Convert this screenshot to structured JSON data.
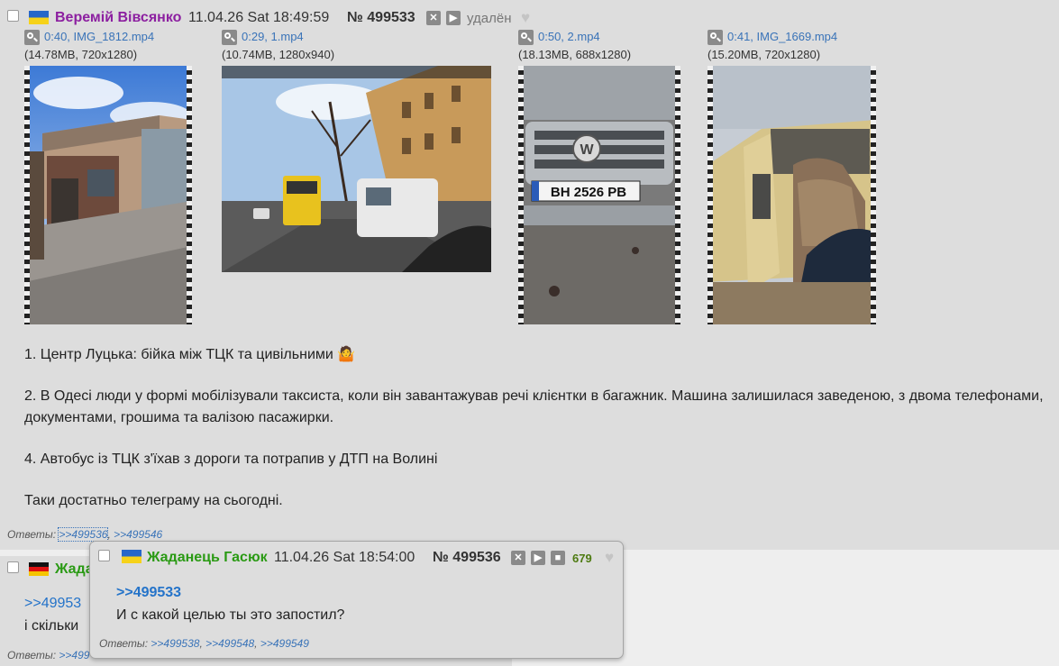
{
  "post1": {
    "name": "Веремій Вівсянко",
    "datetime": "11.04.26 Sat 18:49:59",
    "number": "№ 499533",
    "status": "удалён",
    "files": [
      {
        "label": "0:40, IMG_1812.mp4",
        "info": "(14.78MB, 720x1280)"
      },
      {
        "label": "0:29, 1.mp4",
        "info": "(10.74MB, 1280x940)"
      },
      {
        "label": "0:50, 2.mp4",
        "info": "(18.13MB, 688x1280)"
      },
      {
        "label": "0:41, IMG_1669.mp4",
        "info": "(15.20MB, 720x1280)"
      }
    ],
    "plate_text": "BH 2526 PB",
    "body": [
      "1. Центр Луцька: бійка між ТЦК та цивільними 🤷",
      "2. В Одесі люди у формі мобілізували таксиста, коли він завантажував речі клієнтки в багажник. Машина залишилася заведеною, з двома телефонами, документами, грошима та валізою пасажирки.",
      "4. Автобус із ТЦК з'їхав з дороги та потрапив у ДТП на Волині",
      "Таки достатньо телеграму на сьогодні."
    ],
    "replies_label": "Ответы:",
    "replies": [
      ">>499536",
      ">>499546"
    ]
  },
  "post2": {
    "name_partial": "Жада",
    "quote_partial": ">>49953",
    "text_partial": "і скільки",
    "replies_label": "Ответы:",
    "reply_partial": ">>499"
  },
  "popup": {
    "name": "Жаданець Гасюк",
    "datetime": "11.04.26 Sat 18:54:00",
    "number": "№ 499536",
    "likes": "679",
    "quote": ">>499533",
    "text": "И с какой целью ты это запостил?",
    "replies_label": "Ответы:",
    "replies": [
      ">>499538",
      ">>499548",
      ">>499549"
    ]
  },
  "colors": {
    "post_bg": "#dddddd",
    "page_bg": "#eeeeee",
    "link": "#3973b8",
    "name_purple": "#8c1fa0",
    "name_green": "#2a9a14"
  }
}
